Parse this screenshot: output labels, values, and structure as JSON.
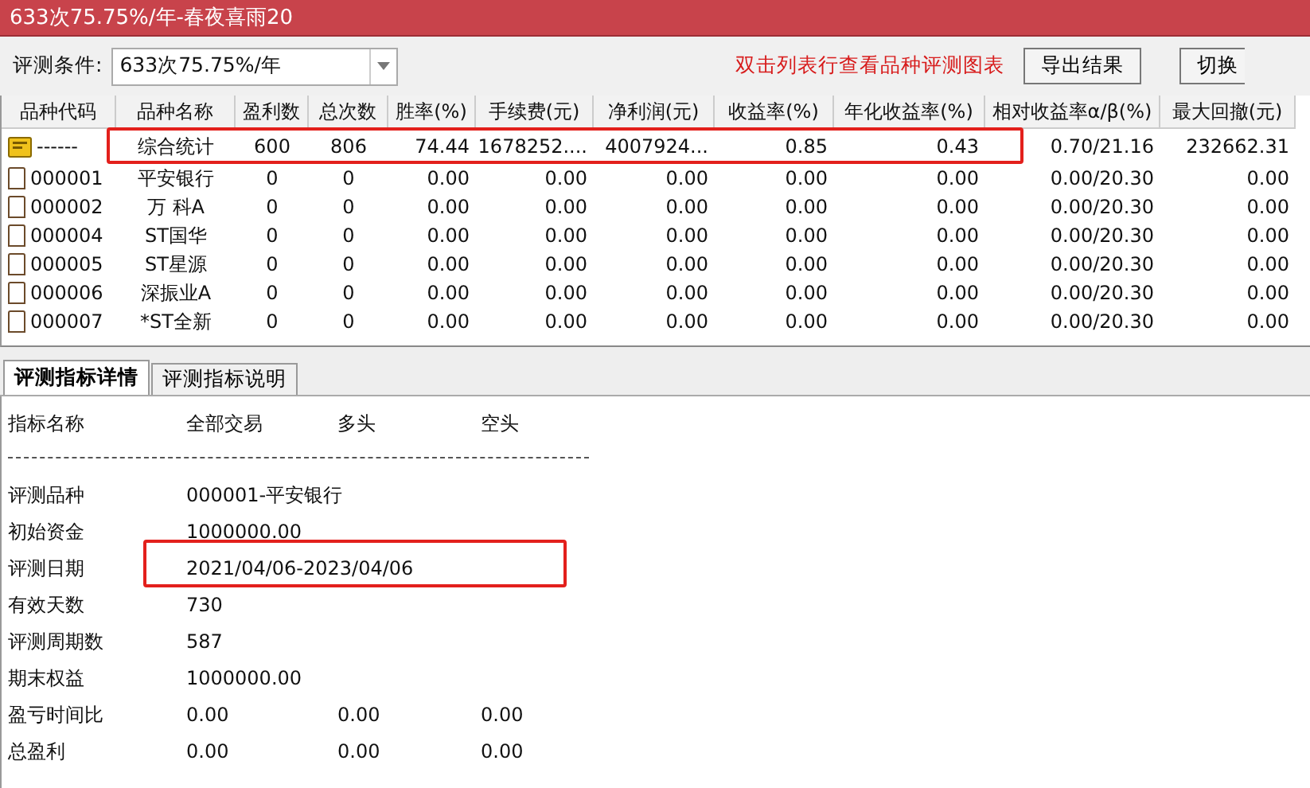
{
  "window": {
    "title": "633次75.75%/年-春夜喜雨20"
  },
  "toolbar": {
    "condition_label": "评测条件:",
    "condition_value": "633次75.75%/年",
    "hint": "双击列表行查看品种评测图表",
    "buttons": [
      "导出结果",
      "切换"
    ]
  },
  "table": {
    "columns": [
      "品种代码",
      "品种名称",
      "盈利数",
      "总次数",
      "胜率(%)",
      "手续费(元)",
      "净利润(元)",
      "收益率(%)",
      "年化收益率(%)",
      "相对收益率α/β(%)",
      "最大回撤(元)"
    ],
    "rows": [
      {
        "kind": "summary",
        "cells": [
          "------",
          "综合统计",
          "600",
          "806",
          "74.44",
          "1678252....",
          "4007924...",
          "0.85",
          "0.43",
          "0.70/21.16",
          "232662.31"
        ]
      },
      {
        "kind": "stock",
        "cells": [
          "000001",
          "平安银行",
          "0",
          "0",
          "0.00",
          "0.00",
          "0.00",
          "0.00",
          "0.00",
          "0.00/20.30",
          "0.00"
        ]
      },
      {
        "kind": "stock",
        "cells": [
          "000002",
          "万 科A",
          "0",
          "0",
          "0.00",
          "0.00",
          "0.00",
          "0.00",
          "0.00",
          "0.00/20.30",
          "0.00"
        ]
      },
      {
        "kind": "stock",
        "cells": [
          "000004",
          "ST国华",
          "0",
          "0",
          "0.00",
          "0.00",
          "0.00",
          "0.00",
          "0.00",
          "0.00/20.30",
          "0.00"
        ]
      },
      {
        "kind": "stock",
        "cells": [
          "000005",
          "ST星源",
          "0",
          "0",
          "0.00",
          "0.00",
          "0.00",
          "0.00",
          "0.00",
          "0.00/20.30",
          "0.00"
        ]
      },
      {
        "kind": "stock",
        "cells": [
          "000006",
          "深振业A",
          "0",
          "0",
          "0.00",
          "0.00",
          "0.00",
          "0.00",
          "0.00",
          "0.00/20.30",
          "0.00"
        ]
      },
      {
        "kind": "stock",
        "cells": [
          "000007",
          "*ST全新",
          "0",
          "0",
          "0.00",
          "0.00",
          "0.00",
          "0.00",
          "0.00",
          "0.00/20.30",
          "0.00"
        ]
      }
    ]
  },
  "tabs": [
    {
      "label": "评测指标详情",
      "selected": true
    },
    {
      "label": "评测指标说明",
      "selected": false
    }
  ],
  "details": {
    "columns": [
      "指标名称",
      "全部交易",
      "多头",
      "空头"
    ],
    "rows": [
      {
        "name": "评测品种",
        "values": [
          "000001-平安银行"
        ]
      },
      {
        "name": "初始资金",
        "values": [
          "1000000.00"
        ]
      },
      {
        "name": "评测日期",
        "values": [
          "2021/04/06-2023/04/06"
        ]
      },
      {
        "name": "有效天数",
        "values": [
          "730"
        ]
      },
      {
        "name": "评测周期数",
        "values": [
          "587"
        ]
      },
      {
        "name": "期末权益",
        "values": [
          "1000000.00"
        ]
      },
      {
        "name": "盈亏时间比",
        "values": [
          "0.00",
          "0.00",
          "0.00"
        ]
      },
      {
        "name": "总盈利",
        "values": [
          "0.00",
          "0.00",
          "0.00"
        ]
      }
    ]
  }
}
